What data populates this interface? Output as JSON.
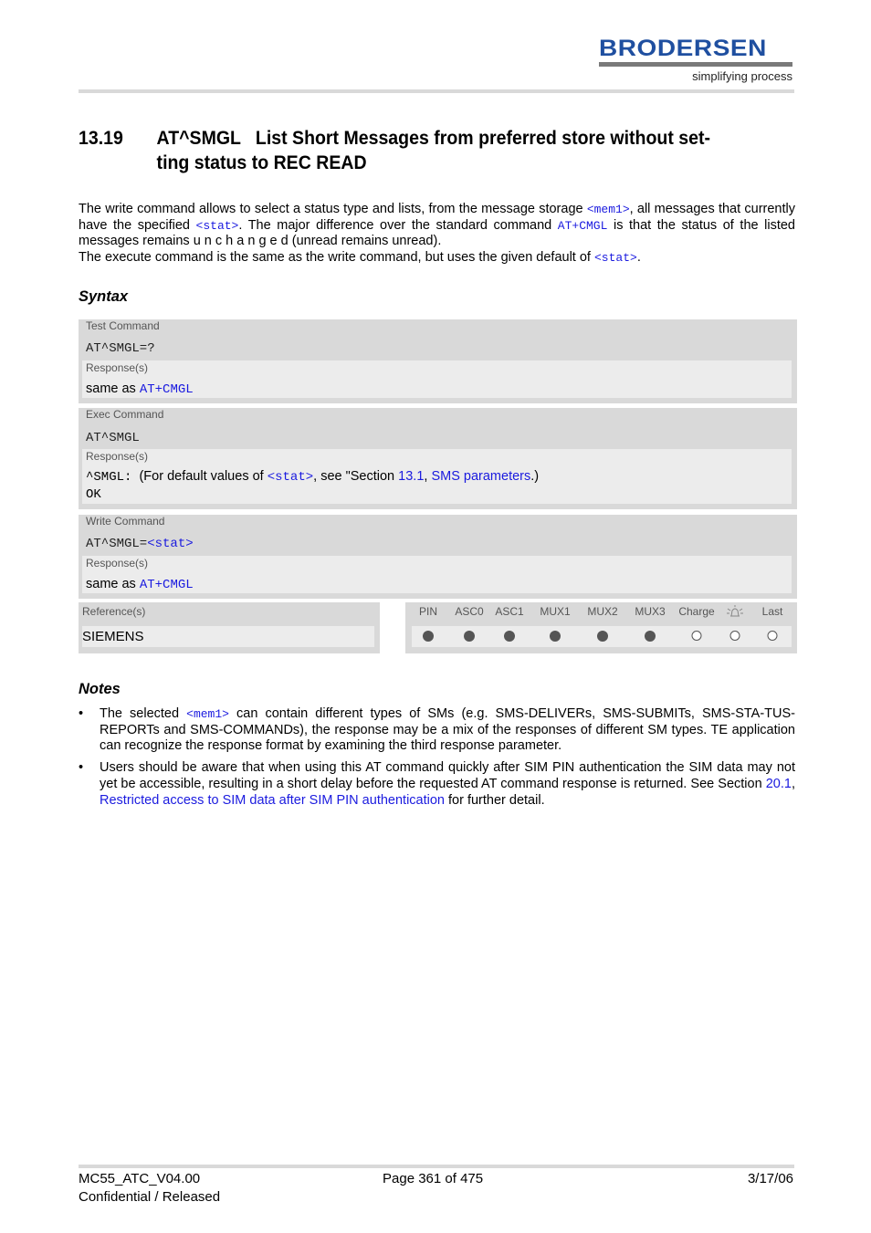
{
  "header": {
    "logo_name": "BRODERSEN",
    "logo_tagline": "simplifying process"
  },
  "heading": {
    "number": "13.19",
    "line1": "AT^SMGL   List Short Messages from preferred store without set-",
    "line2": "ting status to REC READ"
  },
  "intro": {
    "p1_a": "The write command allows to select a status type and lists, from the message storage ",
    "p1_mem1": "<mem1>",
    "p1_b": ", all messages that currently have the specified ",
    "p1_stat": "<stat>",
    "p1_c": ". The major difference over the standard command ",
    "p1_cmgl": "AT+CMGL",
    "p1_d": " is that the status of the listed messages remains u n c h a n g e d (unread remains unread).",
    "p2_a": "The execute command is the same as the write command, but uses the given default of ",
    "p2_stat": "<stat>",
    "p2_b": "."
  },
  "syntax": {
    "title": "Syntax",
    "test": {
      "label": "Test Command",
      "command": "AT^SMGL=?",
      "response_label": "Response(s)",
      "response_prefix": "same as ",
      "response_link": "AT+CMGL"
    },
    "exec": {
      "label": "Exec Command",
      "command": "AT^SMGL",
      "response_label": "Response(s)",
      "response_code": "^SMGL:",
      "response_a": "  (For default values of ",
      "response_stat": "<stat>",
      "response_b": ", see \"Section ",
      "response_section": "13.1",
      "response_c": ", ",
      "response_section_title": "SMS parameters",
      "response_d": ".)",
      "response_ok": "OK"
    },
    "write": {
      "label": "Write Command",
      "command_prefix": "AT^SMGL=",
      "command_param": "<stat>",
      "response_label": "Response(s)",
      "response_prefix": "same as ",
      "response_link": "AT+CMGL"
    },
    "reference": {
      "label": "Reference(s)",
      "value": "SIEMENS"
    },
    "flags": [
      {
        "name": "PIN",
        "state": "filled"
      },
      {
        "name": "ASC0",
        "state": "filled"
      },
      {
        "name": "ASC1",
        "state": "filled"
      },
      {
        "name": "MUX1",
        "state": "filled"
      },
      {
        "name": "MUX2",
        "state": "filled"
      },
      {
        "name": "MUX3",
        "state": "filled"
      },
      {
        "name": "Charge",
        "state": "empty"
      },
      {
        "name": "alarm-icon",
        "state": "empty"
      },
      {
        "name": "Last",
        "state": "empty"
      }
    ]
  },
  "notes": {
    "title": "Notes",
    "bullet": "•",
    "n1_a": "The selected ",
    "n1_mem1": "<mem1>",
    "n1_b": " can contain different types of SMs (e.g. SMS-DELIVERs, SMS-SUBMITs, SMS-STA-TUS-REPORTs and SMS-COMMANDs), the response may be a mix of the responses of different SM types. TE application can recognize the response format by examining the third response parameter.",
    "n2_a": "Users should be aware that when using this AT command quickly after SIM PIN authentication the SIM data may not yet be accessible, resulting in a short delay before the requested AT command response is returned. See Section ",
    "n2_section": "20.1",
    "n2_b": ", ",
    "n2_title": "Restricted access to SIM data after SIM PIN authentication",
    "n2_c": " for further detail."
  },
  "footer": {
    "doc_id": "MC55_ATC_V04.00",
    "classification": "Confidential / Released",
    "page": "Page 361 of 475",
    "date": "3/17/06"
  },
  "colors": {
    "link": "#1a1adf",
    "logo": "#1f4fa0",
    "box_dark": "#d9d9d9",
    "box_light": "#ececec"
  }
}
